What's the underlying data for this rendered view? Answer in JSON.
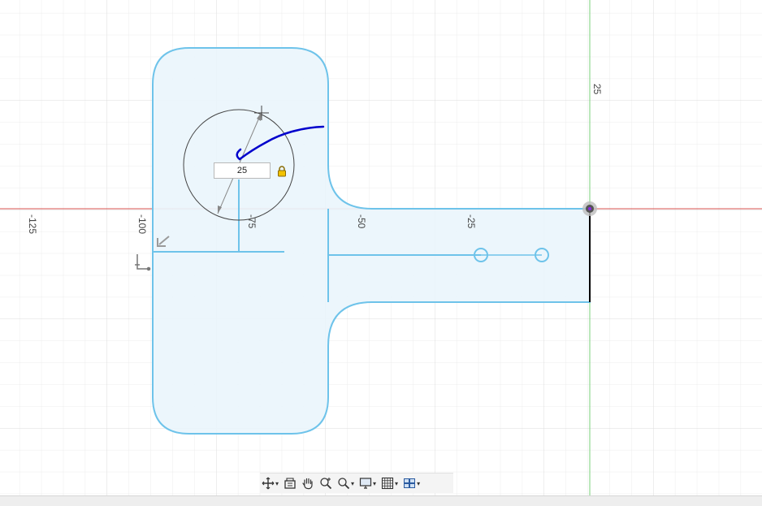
{
  "canvas": {
    "axis_labels": {
      "x": [
        "-125",
        "-100",
        "-75",
        "-50",
        "-25"
      ],
      "y": [
        "25"
      ]
    },
    "dimension_input": {
      "value": "25"
    },
    "colors": {
      "grid_minor": "#ececec",
      "grid_major": "#dcdcdc",
      "x_axis": "#d9534f",
      "y_axis": "#7ad07a",
      "sketch_line": "#6ec3ea",
      "profile_fill": "#eaf5fc",
      "annotation": "#0000cc",
      "selected_line": "#000000"
    },
    "icons": [
      "lock-icon",
      "origin-point-icon",
      "horizontal-constraint-icon",
      "perpendicular-constraint-icon"
    ]
  },
  "toolbar": {
    "items": [
      {
        "name": "orbit-icon",
        "caret": "▾"
      },
      {
        "name": "look-at-icon",
        "caret": ""
      },
      {
        "name": "pan-icon",
        "caret": ""
      },
      {
        "name": "zoom-icon",
        "caret": ""
      },
      {
        "name": "fit-icon",
        "caret": "▾"
      },
      {
        "name": "display-settings-icon",
        "caret": "▾"
      },
      {
        "name": "grid-settings-icon",
        "caret": "▾"
      },
      {
        "name": "viewports-icon",
        "caret": "▾"
      }
    ]
  }
}
